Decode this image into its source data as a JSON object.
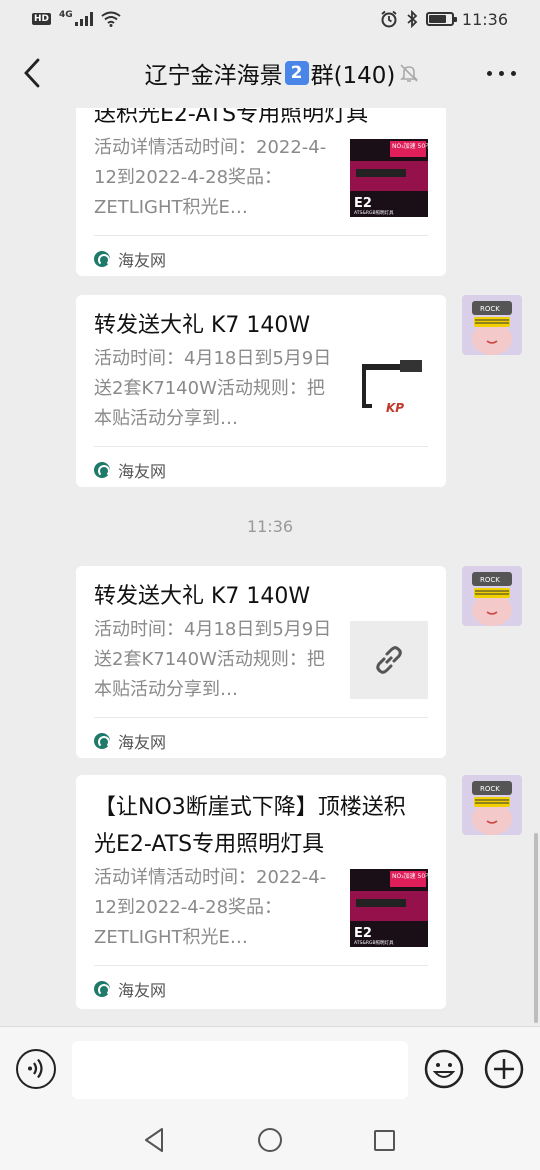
{
  "status": {
    "hd": "HD",
    "net": "4G",
    "time": "11:36"
  },
  "header": {
    "title_prefix": "辽宁金洋海景",
    "title_badge": "2",
    "title_suffix": "群(140)"
  },
  "messages": [
    {
      "title_partial": "送积光E2-ATS专用照明灯具",
      "desc": "活动详情活动时间：2022-4-12到2022-4-28奖品：ZETLIGHT积光E…",
      "source": "海友网",
      "thumb_text_top": "NO₃加速 50不要用",
      "thumb_text_main": "E2",
      "thumb_text_sub": "ATS&RGB照明灯具"
    },
    {
      "title": "转发送大礼 K7 140W",
      "desc": "活动时间：4月18日到5月9日送2套K7140W活动规则：把本贴活动分享到…",
      "source": "海友网",
      "thumb_logo": "KP"
    },
    {
      "time": "11:36"
    },
    {
      "title": "转发送大礼 K7 140W",
      "desc": "活动时间：4月18日到5月9日送2套K7140W活动规则：把本贴活动分享到…",
      "source": "海友网"
    },
    {
      "title": "【让NO3断崖式下降】顶楼送积光E2-ATS专用照明灯具",
      "desc": "活动详情活动时间：2022-4-12到2022-4-28奖品：ZETLIGHT积光E…",
      "source": "海友网",
      "thumb_text_top": "NO₃加速 50不要用",
      "thumb_text_main": "E2",
      "thumb_text_sub": "ATS&RGB照明灯具"
    }
  ],
  "avatar_text": "ROCK"
}
